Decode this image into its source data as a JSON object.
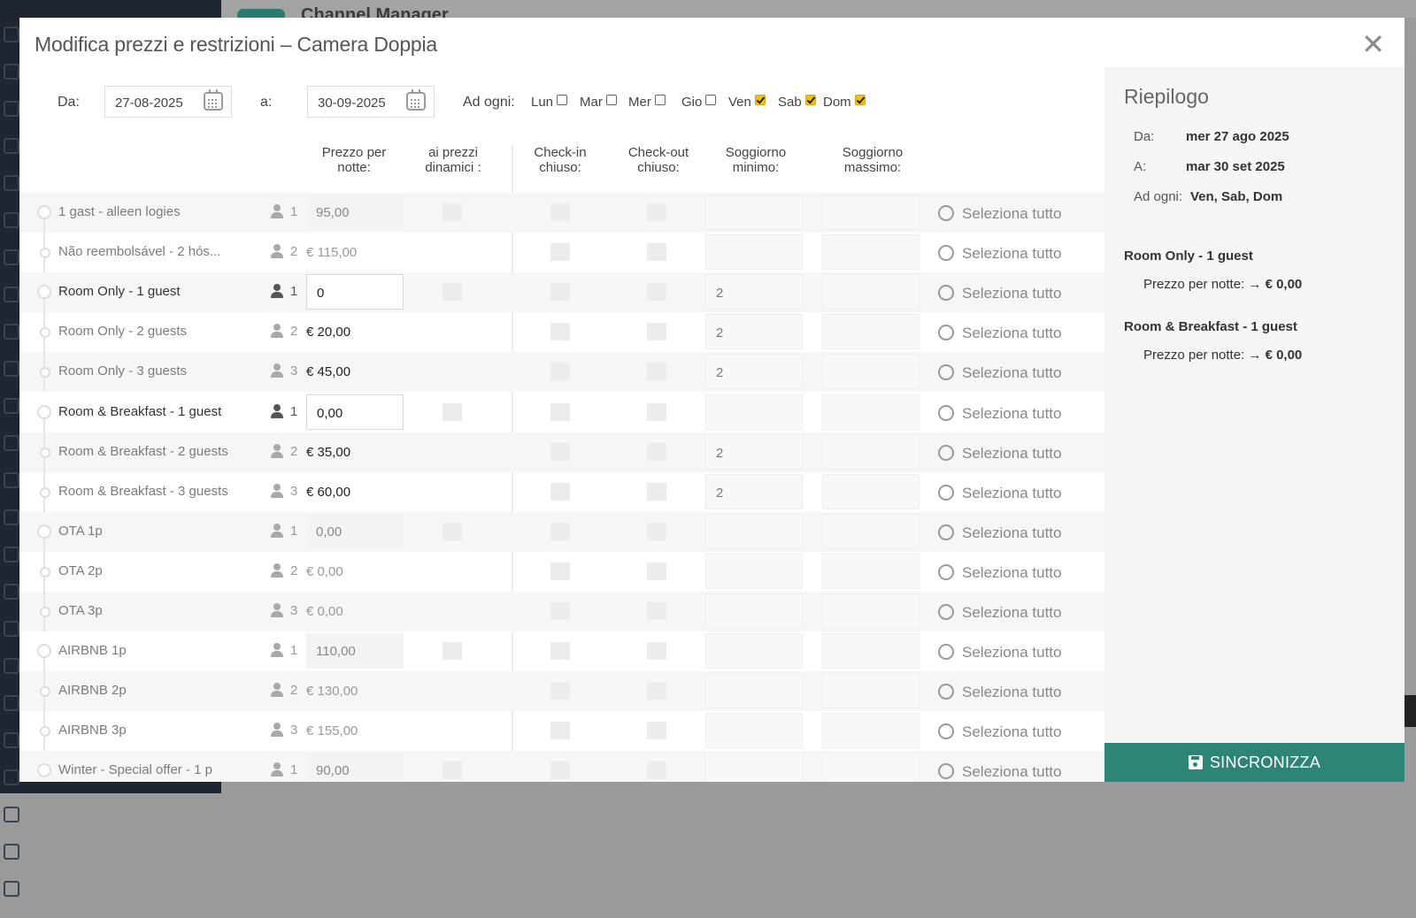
{
  "modal": {
    "title": "Modifica prezzi e restrizioni  –  Camera Doppia",
    "close_icon": "close-icon"
  },
  "filters": {
    "from_label": "Da:",
    "from_value": "27-08-2025",
    "to_label": "a:",
    "to_value": "30-09-2025",
    "every_label": "Ad ogni:",
    "days": [
      {
        "label": "Lun",
        "checked": false
      },
      {
        "label": "Mar",
        "checked": false
      },
      {
        "label": "Mer",
        "checked": false
      },
      {
        "label": "Gio",
        "checked": false
      },
      {
        "label": "Ven",
        "checked": true
      },
      {
        "label": "Sab",
        "checked": true
      },
      {
        "label": "Dom",
        "checked": true
      }
    ]
  },
  "columns": {
    "price": "Prezzo per\nnotte:",
    "dynamic": "ai prezzi\ndinamici :",
    "checkin": "Check-in\nchiuso:",
    "checkout": "Check-out\nchiuso:",
    "min_stay": "Soggiorno\nminimo:",
    "max_stay": "Soggiorno\nmassimo:"
  },
  "select_all_label": "Seleziona tutto",
  "rates": [
    {
      "name": "1 gast - alleen logies",
      "occ": "1",
      "price": "95,00",
      "min": ""
    },
    {
      "name": "Não reembolsável - 2 hós...",
      "occ": "2",
      "price": "€ 115,00",
      "min": ""
    },
    {
      "name": "Room Only - 1 guest",
      "occ": "1",
      "price": "0",
      "min": "2"
    },
    {
      "name": "Room Only - 2 guests",
      "occ": "2",
      "price": "€ 20,00",
      "min": "2"
    },
    {
      "name": "Room Only - 3 guests",
      "occ": "3",
      "price": "€ 45,00",
      "min": "2"
    },
    {
      "name": "Room & Breakfast - 1 guest",
      "occ": "1",
      "price": "0,00",
      "min": ""
    },
    {
      "name": "Room & Breakfast - 2 guests",
      "occ": "2",
      "price": "€ 35,00",
      "min": "2"
    },
    {
      "name": "Room & Breakfast - 3 guests",
      "occ": "3",
      "price": "€ 60,00",
      "min": "2"
    },
    {
      "name": "OTA 1p",
      "occ": "1",
      "price": "0,00",
      "min": ""
    },
    {
      "name": "OTA 2p",
      "occ": "2",
      "price": "€ 0,00",
      "min": ""
    },
    {
      "name": "OTA 3p",
      "occ": "3",
      "price": "€ 0,00",
      "min": ""
    },
    {
      "name": "AIRBNB 1p",
      "occ": "1",
      "price": "110,00",
      "min": ""
    },
    {
      "name": "AIRBNB 2p",
      "occ": "2",
      "price": "€ 130,00",
      "min": ""
    },
    {
      "name": "AIRBNB 3p",
      "occ": "3",
      "price": "€ 155,00",
      "min": ""
    },
    {
      "name": "Winter - Special offer - 1 p",
      "occ": "1",
      "price": "90,00",
      "min": ""
    }
  ],
  "summary": {
    "title": "Riepilogo",
    "from_label": "Da:",
    "from_value": "mer 27 ago 2025",
    "to_label": "A:",
    "to_value": "mar 30 set 2025",
    "every_label": "Ad ogni:",
    "every_value": "Ven, Sab, Dom",
    "changes": [
      {
        "rate": "Room Only - 1 guest",
        "label": "Prezzo per notte:",
        "value": "→ € 0,00"
      },
      {
        "rate": "Room & Breakfast - 1 guest",
        "label": "Prezzo per notte:",
        "value": "→ € 0,00"
      }
    ]
  },
  "sync_button": "SINCRONIZZA",
  "background": {
    "app_title": "Channel Manager"
  },
  "colors": {
    "accent": "#2e8577",
    "checkbox_checked": "#f3c012"
  }
}
